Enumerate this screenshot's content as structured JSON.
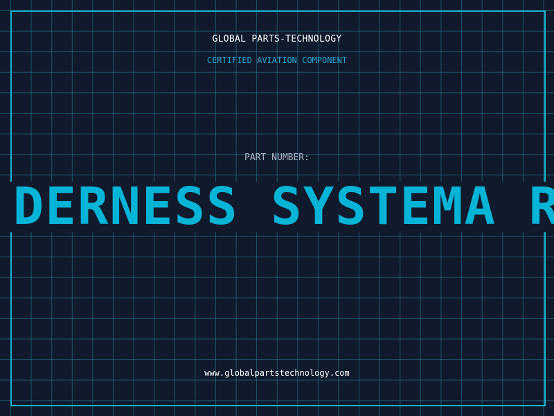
{
  "header": {
    "company_name": "GLOBAL PARTS-TECHNOLOGY",
    "tagline": "CERTIFIED AVIATION COMPONENT"
  },
  "part": {
    "label": "PART NUMBER:",
    "number": "DERNESS SYSTEMA RA"
  },
  "footer": {
    "website": "www.globalpartstechnology.com"
  },
  "colors": {
    "background": "#111a2c",
    "grid": "#2282a0",
    "frame": "#1bb3d3",
    "accent": "#06b4d8",
    "label": "#aab4c4",
    "text": "#ffffff"
  }
}
